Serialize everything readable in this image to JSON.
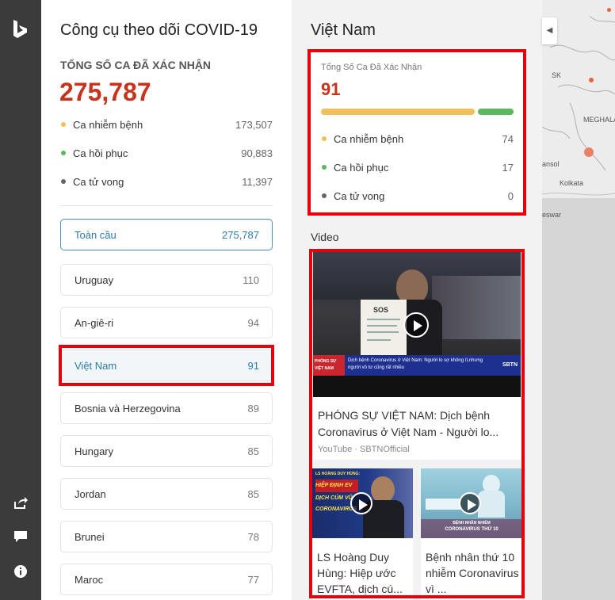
{
  "left_panel": {
    "title": "Công cụ theo dõi COVID-19",
    "total_label": "TỔNG SỐ CA ĐÃ XÁC NHẬN",
    "total_value": "275,787",
    "stats": [
      {
        "label": "Ca nhiễm bệnh",
        "value": "173,507",
        "color": "#f0c05a"
      },
      {
        "label": "Ca hồi phục",
        "value": "90,883",
        "color": "#5cb85c"
      },
      {
        "label": "Ca tử vong",
        "value": "11,397",
        "color": "#666666"
      }
    ],
    "global": {
      "name": "Toàn cầu",
      "value": "275,787"
    },
    "countries": [
      {
        "name": "Uruguay",
        "value": "110"
      },
      {
        "name": "An-giê-ri",
        "value": "94"
      },
      {
        "name": "Việt Nam",
        "value": "91"
      },
      {
        "name": "Bosnia và Herzegovina",
        "value": "89"
      },
      {
        "name": "Hungary",
        "value": "85"
      },
      {
        "name": "Jordan",
        "value": "85"
      },
      {
        "name": "Brunei",
        "value": "78"
      },
      {
        "name": "Maroc",
        "value": "77"
      }
    ]
  },
  "detail": {
    "country": "Việt Nam",
    "card_label": "Tổng Số Ca Đã Xác Nhận",
    "card_value": "91",
    "bar": {
      "active_fraction": 0.81,
      "recovered_fraction": 0.19
    },
    "rows": [
      {
        "label": "Ca nhiễm bệnh",
        "value": "74",
        "color": "#f0c05a"
      },
      {
        "label": "Ca hồi phục",
        "value": "17",
        "color": "#5cb85c"
      },
      {
        "label": "Ca tử vong",
        "value": "0",
        "color": "#666666"
      }
    ],
    "video_heading": "Video",
    "videos": [
      {
        "title": "PHÓNG SỰ VIỆT NAM: Dịch bệnh Coronavirus ở Việt Nam - Người lo...",
        "source": "YouTube · SBTNOfficial"
      },
      {
        "title": "LS Hoàng Duy Hùng: Hiệp ước EVFTA, dịch cú..."
      },
      {
        "title": "Bệnh nhân thứ 10 nhiễm Coronavirus vì ..."
      }
    ],
    "thumb_text": {
      "banner_main": "Dịch bệnh Coronavirus ở Việt Nam: Người lo sợ không ít,nhưng người vô tư cũng rất nhiều",
      "banner_tag": "PHÓNG SỰ VIỆT NAM",
      "banner_brand": "SBTN",
      "sign": "SOS",
      "t2_top": "LS HOÀNG DUY HÙNG:",
      "t2_lines": [
        "HIỆP ĐỊNH EV",
        "DỊCH CÚM VŨ",
        "CORONAVIRUS"
      ],
      "t3_line1": "BỆNH NHÂN NHIỄM",
      "t3_line2": "CORONAVIRUS THỨ 10"
    }
  },
  "map": {
    "labels": [
      "SK",
      "MEGHALA",
      "ansol",
      "Kolkata",
      "eswar"
    ]
  }
}
